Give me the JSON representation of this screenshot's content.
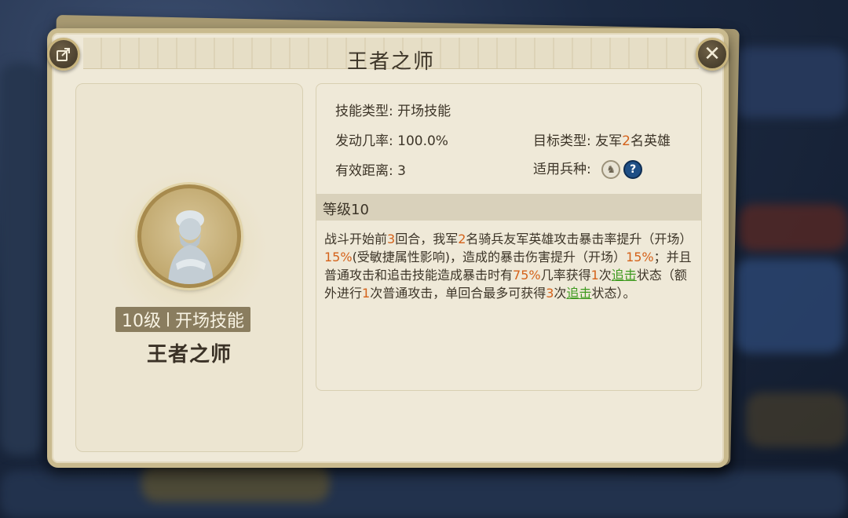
{
  "window": {
    "title": "王者之师"
  },
  "buttons": {
    "share_icon": "share-icon",
    "close_glyph": "✕"
  },
  "skill": {
    "level_label": "10级",
    "type_label": "开场技能",
    "name": "王者之师"
  },
  "info": {
    "skill_type_label": "技能类型:",
    "skill_type_value": "开场技能",
    "trigger_rate_label": "发动几率:",
    "trigger_rate_value": "100.0%",
    "target_type_label": "目标类型:",
    "target_type_pre": "友军",
    "target_type_num": "2",
    "target_type_post": "名英雄",
    "range_label": "有效距离:",
    "range_value": "3",
    "troop_label": "适用兵种:",
    "troop_icons": [
      "cavalry-icon",
      "help-icon"
    ],
    "help_glyph": "?"
  },
  "level_header": "等级10",
  "description": [
    {
      "t": "战斗开始前",
      "c": ""
    },
    {
      "t": "3",
      "c": "orange"
    },
    {
      "t": "回合，我军",
      "c": ""
    },
    {
      "t": "2",
      "c": "orange"
    },
    {
      "t": "名骑兵友军英雄攻击暴击率提升（开场）",
      "c": ""
    },
    {
      "t": "15%",
      "c": "orange"
    },
    {
      "t": "(受敏捷属性影响)，造成的暴击伤害提升（开场）",
      "c": ""
    },
    {
      "t": "15%",
      "c": "orange"
    },
    {
      "t": "；并且普通攻击和追击技能造成暴击时有",
      "c": ""
    },
    {
      "t": "75%",
      "c": "orange"
    },
    {
      "t": "几率获得",
      "c": ""
    },
    {
      "t": "1",
      "c": "orange"
    },
    {
      "t": "次",
      "c": ""
    },
    {
      "t": "追击",
      "c": "green"
    },
    {
      "t": "状态（额外进行",
      "c": ""
    },
    {
      "t": "1",
      "c": "orange"
    },
    {
      "t": "次普通攻击，单回合最多可获得",
      "c": ""
    },
    {
      "t": "3",
      "c": "orange"
    },
    {
      "t": "次",
      "c": ""
    },
    {
      "t": "追击",
      "c": "green"
    },
    {
      "t": "状态）。",
      "c": ""
    }
  ],
  "colors": {
    "highlight_orange": "#d4621a",
    "highlight_green": "#3e9a1f",
    "panel_bg": "#efe9d8"
  }
}
